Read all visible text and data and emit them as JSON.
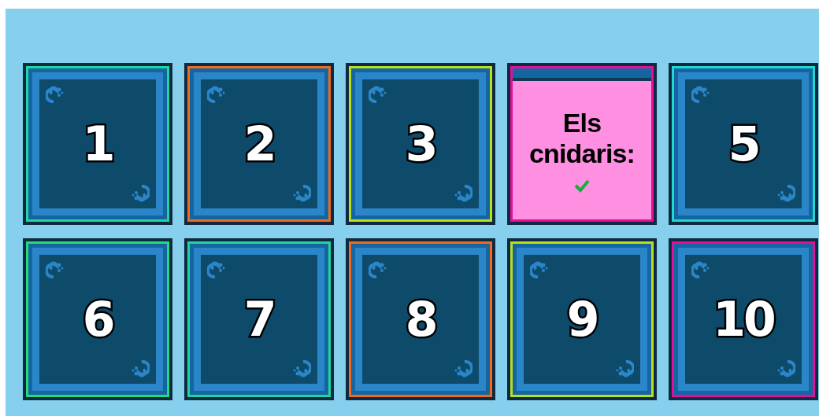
{
  "tiles": [
    {
      "kind": "hidden",
      "label": "1",
      "color": "#1dd6a0"
    },
    {
      "kind": "hidden",
      "label": "2",
      "color": "#f06a1e"
    },
    {
      "kind": "hidden",
      "label": "3",
      "color": "#b8e020"
    },
    {
      "kind": "revealed",
      "text": "Els cnidaris:",
      "correct": true,
      "color": "#e0109a"
    },
    {
      "kind": "hidden",
      "label": "5",
      "color": "#20d8d0"
    },
    {
      "kind": "hidden",
      "label": "6",
      "color": "#22dc7a"
    },
    {
      "kind": "hidden",
      "label": "7",
      "color": "#1dd6a0"
    },
    {
      "kind": "hidden",
      "label": "8",
      "color": "#f06a1e"
    },
    {
      "kind": "hidden",
      "label": "9",
      "color": "#b8e020"
    },
    {
      "kind": "hidden",
      "label": "10",
      "color": "#e0109a"
    }
  ]
}
